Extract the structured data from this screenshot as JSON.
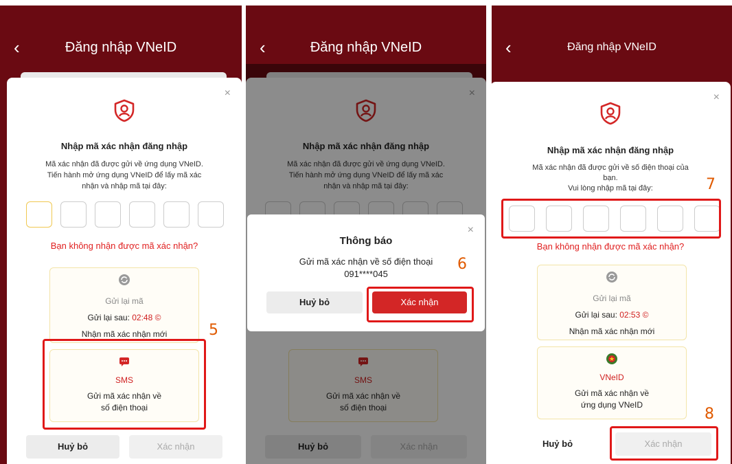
{
  "header": {
    "back_icon": "‹",
    "title": "Đăng nhập VNeID"
  },
  "sheet": {
    "close_icon": "×",
    "title": "Nhập mã xác nhận đăng nhập",
    "desc_app": "Mã xác nhận đã được gửi về ứng dụng VNeID.\nTiến hành mở ứng dụng VNeID để lấy mã xác\nnhận và nhập mã tại đây:",
    "desc_phone": "Mã xác nhận đã được gửi về số điện thoại của\nbạn.\nVui lòng nhập mã tại đây:",
    "no_code_link": "Bạn không nhận được mã xác nhận?"
  },
  "resend": {
    "label": "Gửi lại mã",
    "timer_prefix": "Gửi lại sau:",
    "timer_1": "02:48",
    "timer_3": "02:53",
    "new_code": "Nhận mã xác nhận mới"
  },
  "sms": {
    "label": "SMS",
    "desc": "Gửi mã xác nhận về\nsố điện thoại"
  },
  "vneid": {
    "label": "VNeID",
    "desc": "Gửi mã xác nhận về\nứng dụng VNeID"
  },
  "buttons": {
    "cancel": "Huỷ bỏ",
    "confirm": "Xác nhận"
  },
  "dialog": {
    "title": "Thông báo",
    "text": "Gửi mã xác nhận về số điện thoại\n091****045",
    "cancel": "Huỷ bỏ",
    "confirm": "Xác nhận"
  },
  "steps": {
    "s5": "5",
    "s6": "6",
    "s7": "7",
    "s8": "8"
  },
  "colors": {
    "header": "#6a0a12",
    "accent": "#d32626",
    "highlight": "#e01818",
    "step_number": "#e05a00"
  }
}
